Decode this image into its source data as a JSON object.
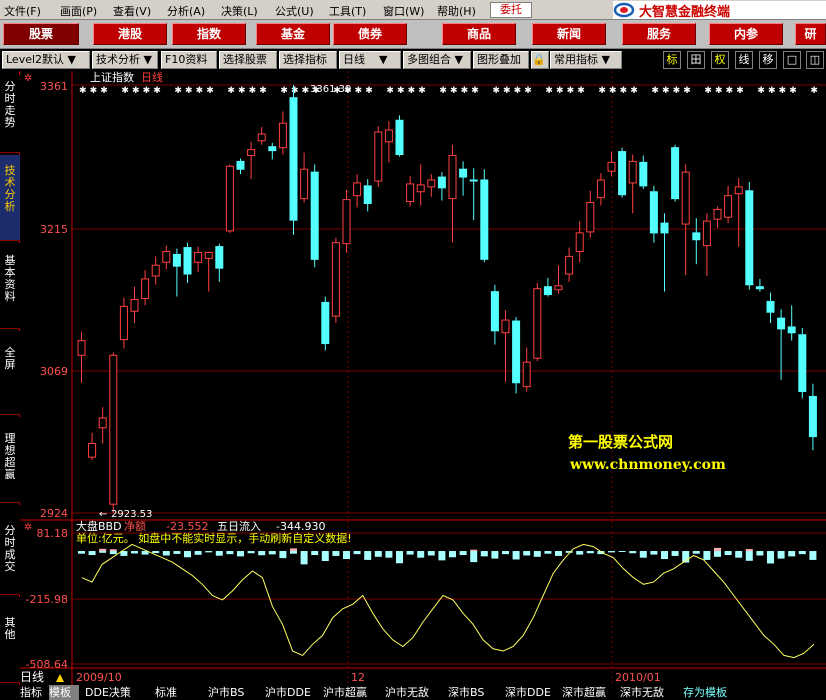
{
  "menu": {
    "items": [
      "文件(F)",
      "画面(P)",
      "查看(V)",
      "分析(A)",
      "决策(L)",
      "公式(U)",
      "工具(T)",
      "窗口(W)",
      "帮助(H)"
    ],
    "weituo_label": "委托",
    "brand_title": "大智慧金融终端"
  },
  "nav": {
    "buttons": [
      "股票",
      "港股",
      "指数",
      "基金",
      "债券",
      "商品",
      "新闻",
      "服务",
      "内参",
      "研"
    ]
  },
  "toolbar": {
    "level2": "Level2默认",
    "tech_analysis": "技术分析",
    "f10": "F10资料",
    "select_stock": "选择股票",
    "select_indicator": "选择指标",
    "period": "日线",
    "multi_chart": "多图组合",
    "overlay": "图形叠加",
    "common_indicator": "常用指标",
    "right_buttons": [
      "标",
      "田",
      "权",
      "线",
      "移",
      "□",
      "◫"
    ]
  },
  "sidebar": {
    "items": [
      "分时走势",
      "技术分析",
      "基本资料",
      "全屏",
      "理想超赢",
      "分时成交",
      "其他"
    ],
    "active_index": 1
  },
  "chart_title": {
    "name": "上证指数",
    "period": "日线"
  },
  "main_axis": {
    "labels": [
      "3361",
      "3215",
      "3069",
      "2924"
    ]
  },
  "annotations": {
    "high": "3361.39",
    "low": "2923.53"
  },
  "sub_panel": {
    "indicator": "大盘BBD",
    "net_label": "净额",
    "net_value": "-23.552",
    "five_day_label": "五日流入",
    "five_day_value": "-344.930",
    "note": "单位:亿元。 如盘中不能实时显示，手动刷新自定义数据!",
    "axis_labels": [
      "81.18",
      "-215.98",
      "-508.64"
    ]
  },
  "date_axis": {
    "period_label": "日线",
    "labels": [
      "2009/10",
      "12",
      "2010/01"
    ]
  },
  "watermark": {
    "line1": "第一股票公式网",
    "line2": "www.chnmoney.com"
  },
  "bottom_tabs": {
    "items": [
      "指标",
      "模板",
      "DDE决策",
      "标准",
      "沪市BS",
      "沪市DDE",
      "沪市超赢",
      "沪市无敌",
      "深市BS",
      "深市DDE",
      "深市超赢",
      "深市无敌",
      "存为模板"
    ],
    "selected_index": 1
  },
  "chart_data": {
    "type": "candlestick",
    "title": "上证指数",
    "ylim": [
      2924,
      3361
    ],
    "candles": [
      {
        "o": 3085,
        "c": 3100,
        "h": 3109,
        "l": 3057,
        "up": true
      },
      {
        "o": 2981,
        "c": 2995,
        "h": 3006,
        "l": 2978,
        "up": true
      },
      {
        "o": 3011,
        "c": 3021,
        "h": 3032,
        "l": 2995,
        "up": true
      },
      {
        "o": 2933,
        "c": 3085,
        "h": 3088,
        "l": 2924,
        "up": true
      },
      {
        "o": 3101,
        "c": 3135,
        "h": 3144,
        "l": 3092,
        "up": true
      },
      {
        "o": 3130,
        "c": 3142,
        "h": 3155,
        "l": 3118,
        "up": true
      },
      {
        "o": 3143,
        "c": 3163,
        "h": 3172,
        "l": 3136,
        "up": true
      },
      {
        "o": 3166,
        "c": 3177,
        "h": 3186,
        "l": 3157,
        "up": true
      },
      {
        "o": 3191,
        "c": 3180,
        "h": 3197,
        "l": 3173,
        "up": true
      },
      {
        "o": 3188,
        "c": 3176,
        "h": 3194,
        "l": 3145,
        "up": false
      },
      {
        "o": 3195,
        "c": 3168,
        "h": 3200,
        "l": 3159,
        "up": false
      },
      {
        "o": 3190,
        "c": 3180,
        "h": 3196,
        "l": 3170,
        "up": true
      },
      {
        "o": 3184,
        "c": 3190,
        "h": 3191,
        "l": 3150,
        "up": true
      },
      {
        "o": 3196,
        "c": 3174,
        "h": 3199,
        "l": 3160,
        "up": false
      },
      {
        "o": 3212,
        "c": 3278,
        "h": 3280,
        "l": 3210,
        "up": true
      },
      {
        "o": 3283,
        "c": 3275,
        "h": 3286,
        "l": 3270,
        "up": false
      },
      {
        "o": 3289,
        "c": 3295,
        "h": 3303,
        "l": 3265,
        "up": true
      },
      {
        "o": 3304,
        "c": 3311,
        "h": 3318,
        "l": 3300,
        "up": true
      },
      {
        "o": 3298,
        "c": 3294,
        "h": 3302,
        "l": 3285,
        "up": false
      },
      {
        "o": 3297,
        "c": 3322,
        "h": 3334,
        "l": 3290,
        "up": true
      },
      {
        "o": 3348,
        "c": 3223,
        "h": 3361,
        "l": 3208,
        "up": false
      },
      {
        "o": 3245,
        "c": 3275,
        "h": 3292,
        "l": 3241,
        "up": true
      },
      {
        "o": 3272,
        "c": 3183,
        "h": 3280,
        "l": 3175,
        "up": false
      },
      {
        "o": 3139,
        "c": 3097,
        "h": 3145,
        "l": 3090,
        "up": false
      },
      {
        "o": 3125,
        "c": 3200,
        "h": 3205,
        "l": 3118,
        "up": true
      },
      {
        "o": 3199,
        "c": 3244,
        "h": 3254,
        "l": 3190,
        "up": true
      },
      {
        "o": 3248,
        "c": 3261,
        "h": 3270,
        "l": 3236,
        "up": true
      },
      {
        "o": 3258,
        "c": 3240,
        "h": 3265,
        "l": 3232,
        "up": false
      },
      {
        "o": 3263,
        "c": 3313,
        "h": 3319,
        "l": 3257,
        "up": true
      },
      {
        "o": 3303,
        "c": 3315,
        "h": 3324,
        "l": 3282,
        "up": true
      },
      {
        "o": 3325,
        "c": 3290,
        "h": 3330,
        "l": 3288,
        "up": false
      },
      {
        "o": 3242,
        "c": 3260,
        "h": 3268,
        "l": 3237,
        "up": true
      },
      {
        "o": 3259,
        "c": 3252,
        "h": 3280,
        "l": 3238,
        "up": true
      },
      {
        "o": 3257,
        "c": 3264,
        "h": 3270,
        "l": 3247,
        "up": true
      },
      {
        "o": 3267,
        "c": 3256,
        "h": 3272,
        "l": 3243,
        "up": false
      },
      {
        "o": 3245,
        "c": 3289,
        "h": 3300,
        "l": 3200,
        "up": true
      },
      {
        "o": 3275,
        "c": 3267,
        "h": 3283,
        "l": 3248,
        "up": false
      },
      {
        "o": 3264,
        "c": 3264,
        "h": 3276,
        "l": 3223,
        "up": false
      },
      {
        "o": 3264,
        "c": 3183,
        "h": 3275,
        "l": 3180,
        "up": false
      },
      {
        "o": 3150,
        "c": 3110,
        "h": 3157,
        "l": 3096,
        "up": false
      },
      {
        "o": 3108,
        "c": 3121,
        "h": 3131,
        "l": 3058,
        "up": true
      },
      {
        "o": 3120,
        "c": 3057,
        "h": 3124,
        "l": 3046,
        "up": false
      },
      {
        "o": 3053,
        "c": 3078,
        "h": 3093,
        "l": 3048,
        "up": true
      },
      {
        "o": 3082,
        "c": 3153,
        "h": 3159,
        "l": 3079,
        "up": true
      },
      {
        "o": 3155,
        "c": 3147,
        "h": 3164,
        "l": 3145,
        "up": false
      },
      {
        "o": 3152,
        "c": 3156,
        "h": 3177,
        "l": 3148,
        "up": true
      },
      {
        "o": 3168,
        "c": 3186,
        "h": 3195,
        "l": 3160,
        "up": true
      },
      {
        "o": 3191,
        "c": 3210,
        "h": 3222,
        "l": 3180,
        "up": true
      },
      {
        "o": 3211,
        "c": 3241,
        "h": 3253,
        "l": 3205,
        "up": true
      },
      {
        "o": 3246,
        "c": 3264,
        "h": 3271,
        "l": 3238,
        "up": true
      },
      {
        "o": 3273,
        "c": 3282,
        "h": 3293,
        "l": 3268,
        "up": true
      },
      {
        "o": 3293,
        "c": 3249,
        "h": 3297,
        "l": 3246,
        "up": false
      },
      {
        "o": 3261,
        "c": 3283,
        "h": 3290,
        "l": 3230,
        "up": true
      },
      {
        "o": 3282,
        "c": 3258,
        "h": 3289,
        "l": 3255,
        "up": false
      },
      {
        "o": 3252,
        "c": 3210,
        "h": 3258,
        "l": 3200,
        "up": false
      },
      {
        "o": 3220,
        "c": 3210,
        "h": 3230,
        "l": 3150,
        "up": false
      },
      {
        "o": 3297,
        "c": 3245,
        "h": 3300,
        "l": 3242,
        "up": false
      },
      {
        "o": 3219,
        "c": 3272,
        "h": 3280,
        "l": 3167,
        "up": true
      },
      {
        "o": 3210,
        "c": 3203,
        "h": 3225,
        "l": 3178,
        "up": false
      },
      {
        "o": 3197,
        "c": 3222,
        "h": 3230,
        "l": 3166,
        "up": true
      },
      {
        "o": 3224,
        "c": 3234,
        "h": 3237,
        "l": 3215,
        "up": true
      },
      {
        "o": 3226,
        "c": 3248,
        "h": 3258,
        "l": 3220,
        "up": true
      },
      {
        "o": 3250,
        "c": 3257,
        "h": 3266,
        "l": 3196,
        "up": true
      },
      {
        "o": 3253,
        "c": 3157,
        "h": 3262,
        "l": 3152,
        "up": false
      },
      {
        "o": 3155,
        "c": 3153,
        "h": 3163,
        "l": 3150,
        "up": false
      },
      {
        "o": 3140,
        "c": 3129,
        "h": 3149,
        "l": 3118,
        "up": false
      },
      {
        "o": 3123,
        "c": 3112,
        "h": 3132,
        "l": 3060,
        "up": false
      },
      {
        "o": 3114,
        "c": 3108,
        "h": 3136,
        "l": 3100,
        "up": false
      },
      {
        "o": 3106,
        "c": 3048,
        "h": 3113,
        "l": 3041,
        "up": false
      },
      {
        "o": 3043,
        "c": 3002,
        "h": 3056,
        "l": 2988,
        "up": false
      }
    ],
    "bbd_axis": [
      -508.64,
      81.18
    ],
    "bbd_bars": [
      -12,
      -18,
      -8,
      -14,
      -22,
      -11,
      -16,
      -9,
      -20,
      -13,
      -28,
      -17,
      -6,
      -21,
      -14,
      -24,
      -10,
      -19,
      -15,
      -32,
      -12,
      -60,
      -18,
      -45,
      -22,
      -36,
      -14,
      -40,
      -26,
      -30,
      -55,
      -16,
      -30,
      -20,
      -42,
      -28,
      -18,
      -50,
      -24,
      -34,
      -14,
      -38,
      -20,
      -26,
      -12,
      -22,
      -8,
      -16,
      -10,
      -14,
      -6,
      -4,
      -10,
      -30,
      -16,
      -36,
      -22,
      -52,
      -12,
      -40,
      -26,
      -18,
      -30,
      -44,
      -20,
      -56,
      -34,
      -24,
      -14,
      -40
    ],
    "bbd_pos": [
      {
        "i": 2,
        "v": 10
      },
      {
        "i": 3,
        "v": 8
      },
      {
        "i": 20,
        "v": 12
      },
      {
        "i": 37,
        "v": 6
      },
      {
        "i": 60,
        "v": 14
      },
      {
        "i": 63,
        "v": 9
      }
    ],
    "bbd_line": [
      -120,
      -140,
      -60,
      -30,
      0,
      30,
      10,
      -10,
      -30,
      -50,
      -80,
      -110,
      -150,
      -200,
      -220,
      -180,
      -130,
      -90,
      -120,
      -250,
      -330,
      -450,
      -470,
      -420,
      -380,
      -300,
      -260,
      -240,
      -200,
      -280,
      -350,
      -400,
      -430,
      -390,
      -320,
      -260,
      -200,
      -220,
      -280,
      -330,
      -400,
      -440,
      -450,
      -430,
      -380,
      -300,
      -200,
      -100,
      -40,
      10,
      30,
      20,
      -10,
      -30,
      -80,
      -120,
      -150,
      -140,
      -100,
      -80,
      -50,
      -20,
      -40,
      -90,
      -140,
      -200,
      -260,
      -320,
      -380,
      -420,
      -470,
      -480,
      -460,
      -420
    ]
  }
}
